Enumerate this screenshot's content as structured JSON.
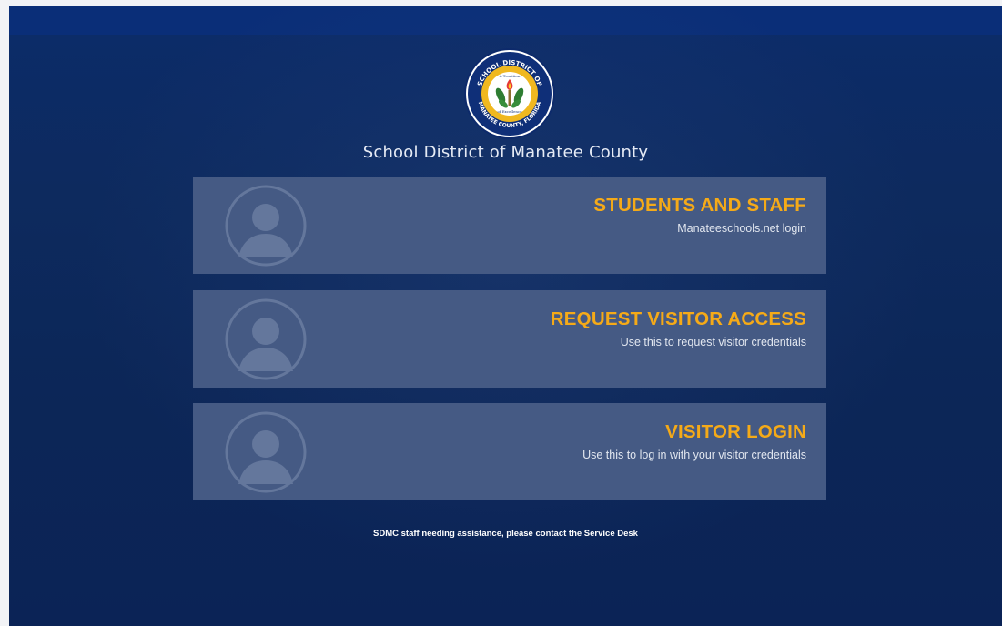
{
  "header": {
    "logo": {
      "top_text": "SCHOOL DISTRICT OF",
      "bottom_text": "MANATEE COUNTY, FLORIDA",
      "inner_top": "A Tradition",
      "inner_bottom": "of Excellence",
      "colors": {
        "ring": "#0d2a6b",
        "gold": "#f0b81f",
        "green": "#2e7d32",
        "white": "#ffffff"
      }
    },
    "org_name": "School District of Manatee County"
  },
  "options": [
    {
      "title": "STUDENTS AND STAFF",
      "subtitle": "Manateeschools.net login"
    },
    {
      "title": "REQUEST VISITOR ACCESS",
      "subtitle": "Use this to request visitor credentials"
    },
    {
      "title": "VISITOR LOGIN",
      "subtitle": "Use this to log in with your visitor credentials"
    }
  ],
  "footer": {
    "note": "SDMC staff needing assistance, please contact the Service Desk"
  },
  "colors": {
    "background": "#0c2a60",
    "card": "#455a84",
    "accent": "#f5aa18",
    "text": "#e6ebf5"
  }
}
